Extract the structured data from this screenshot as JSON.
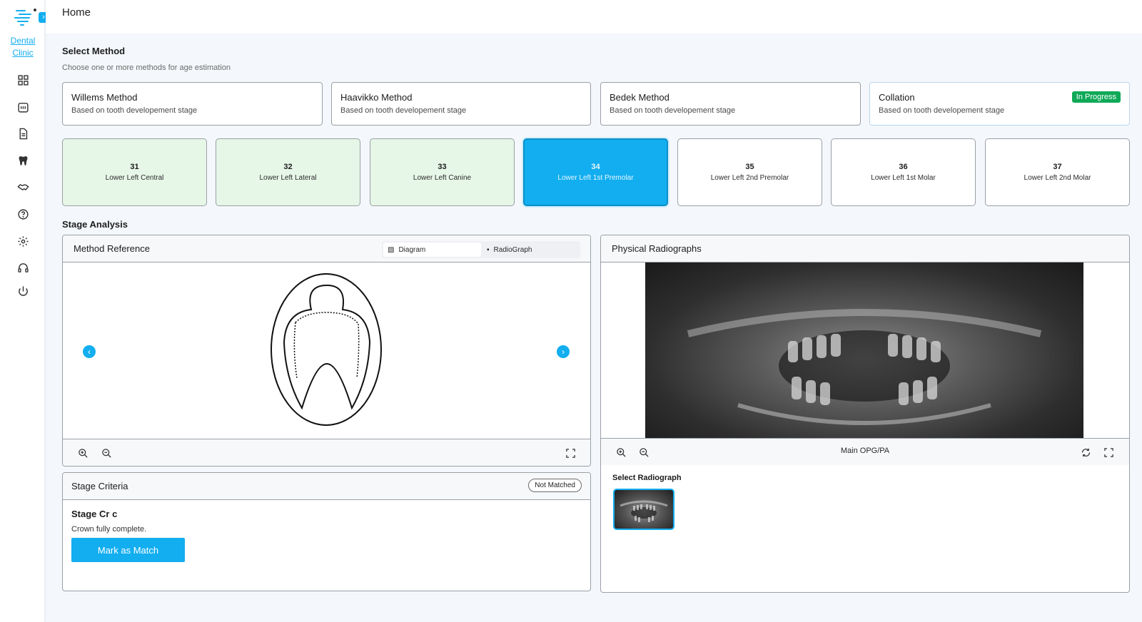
{
  "app": {
    "page_title": "Home",
    "clinic_name": "Dental Clinic"
  },
  "sidebar": {
    "icons": [
      "dashboard-icon",
      "calendar-icon",
      "document-icon",
      "tooth-icon",
      "handshake-icon",
      "help-icon",
      "settings-icon",
      "headset-icon",
      "power-icon"
    ]
  },
  "select_method": {
    "title": "Select Method",
    "subtitle": "Choose one or more methods for age estimation",
    "methods": [
      {
        "name": "Willems Method",
        "desc": "Based on tooth developement stage"
      },
      {
        "name": "Haavikko Method",
        "desc": "Based on tooth developement stage"
      },
      {
        "name": "Bedek Method",
        "desc": "Based on tooth developement stage"
      },
      {
        "name": "Collation",
        "desc": "Based on tooth developement stage",
        "badge": "In Progress"
      }
    ]
  },
  "teeth": [
    {
      "num": "31",
      "name": "Lower Left Central",
      "state": "done"
    },
    {
      "num": "32",
      "name": "Lower Left Lateral",
      "state": "done"
    },
    {
      "num": "33",
      "name": "Lower Left Canine",
      "state": "done"
    },
    {
      "num": "34",
      "name": "Lower Left 1st Premolar",
      "state": "selected"
    },
    {
      "num": "35",
      "name": "Lower Left 2nd Premolar",
      "state": "pending"
    },
    {
      "num": "36",
      "name": "Lower Left 1st Molar",
      "state": "pending"
    },
    {
      "num": "37",
      "name": "Lower Left 2nd Molar",
      "state": "pending"
    }
  ],
  "stage_analysis": {
    "title": "Stage Analysis",
    "method_reference": {
      "title": "Method Reference",
      "tab_diagram": "Diagram",
      "tab_radiograph": "RadioGraph",
      "active_tab": "Diagram"
    },
    "stage_criteria": {
      "title": "Stage Criteria",
      "status": "Not Matched",
      "stage_name": "Stage Cr c",
      "stage_desc": "Crown fully complete.",
      "button": "Mark as Match"
    },
    "radiographs": {
      "title": "Physical Radiographs",
      "footer_label": "Main OPG/PA",
      "select_label": "Select Radiograph"
    }
  },
  "colors": {
    "accent": "#12aef0",
    "done_bg": "#e6f6e7",
    "badge_green": "#0fa958"
  }
}
